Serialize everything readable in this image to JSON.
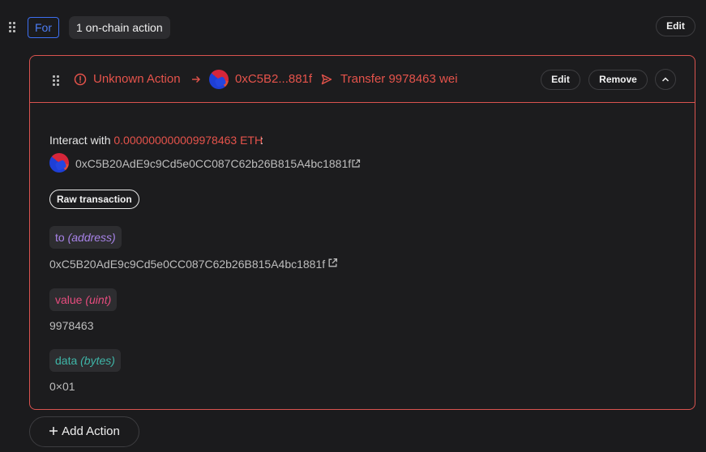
{
  "header": {
    "for_label": "For",
    "actions_count_label": "1 on-chain action",
    "edit_label": "Edit"
  },
  "action_card": {
    "title": "Unknown Action",
    "short_address": "0xC5B2...881f",
    "transfer_summary": "Transfer 9978463 wei",
    "edit_label": "Edit",
    "remove_label": "Remove",
    "interact_prefix": "Interact with",
    "interact_amount": "0.000000000009978463 ETH",
    "interact_suffix": ":",
    "contract_address": "0xC5B20AdE9c9Cd5e0CC087C62b26B815A4bc1881f",
    "raw_transaction_label": "Raw transaction",
    "params": [
      {
        "name": "to",
        "type": "(address)",
        "value": "0xC5B20AdE9c9Cd5e0CC087C62b26B815A4bc1881f"
      },
      {
        "name": "value",
        "type": "(uint)",
        "value": "9978463"
      },
      {
        "name": "data",
        "type": "(bytes)",
        "value": "0×01"
      }
    ]
  },
  "add_action_label": "Add Action",
  "icons": {
    "drag": "drag-handle-icon",
    "warning": "alert-circle-icon",
    "arrow": "arrow-right-icon",
    "send": "send-icon",
    "external": "external-link-icon",
    "collapse": "chevron-up-icon",
    "plus": "plus-icon"
  },
  "colors": {
    "accent_blue": "#4c7df5",
    "error_red": "#e5534b",
    "param_to": "#a883e8",
    "param_value": "#e64c7e",
    "param_data": "#3fb6a8"
  }
}
